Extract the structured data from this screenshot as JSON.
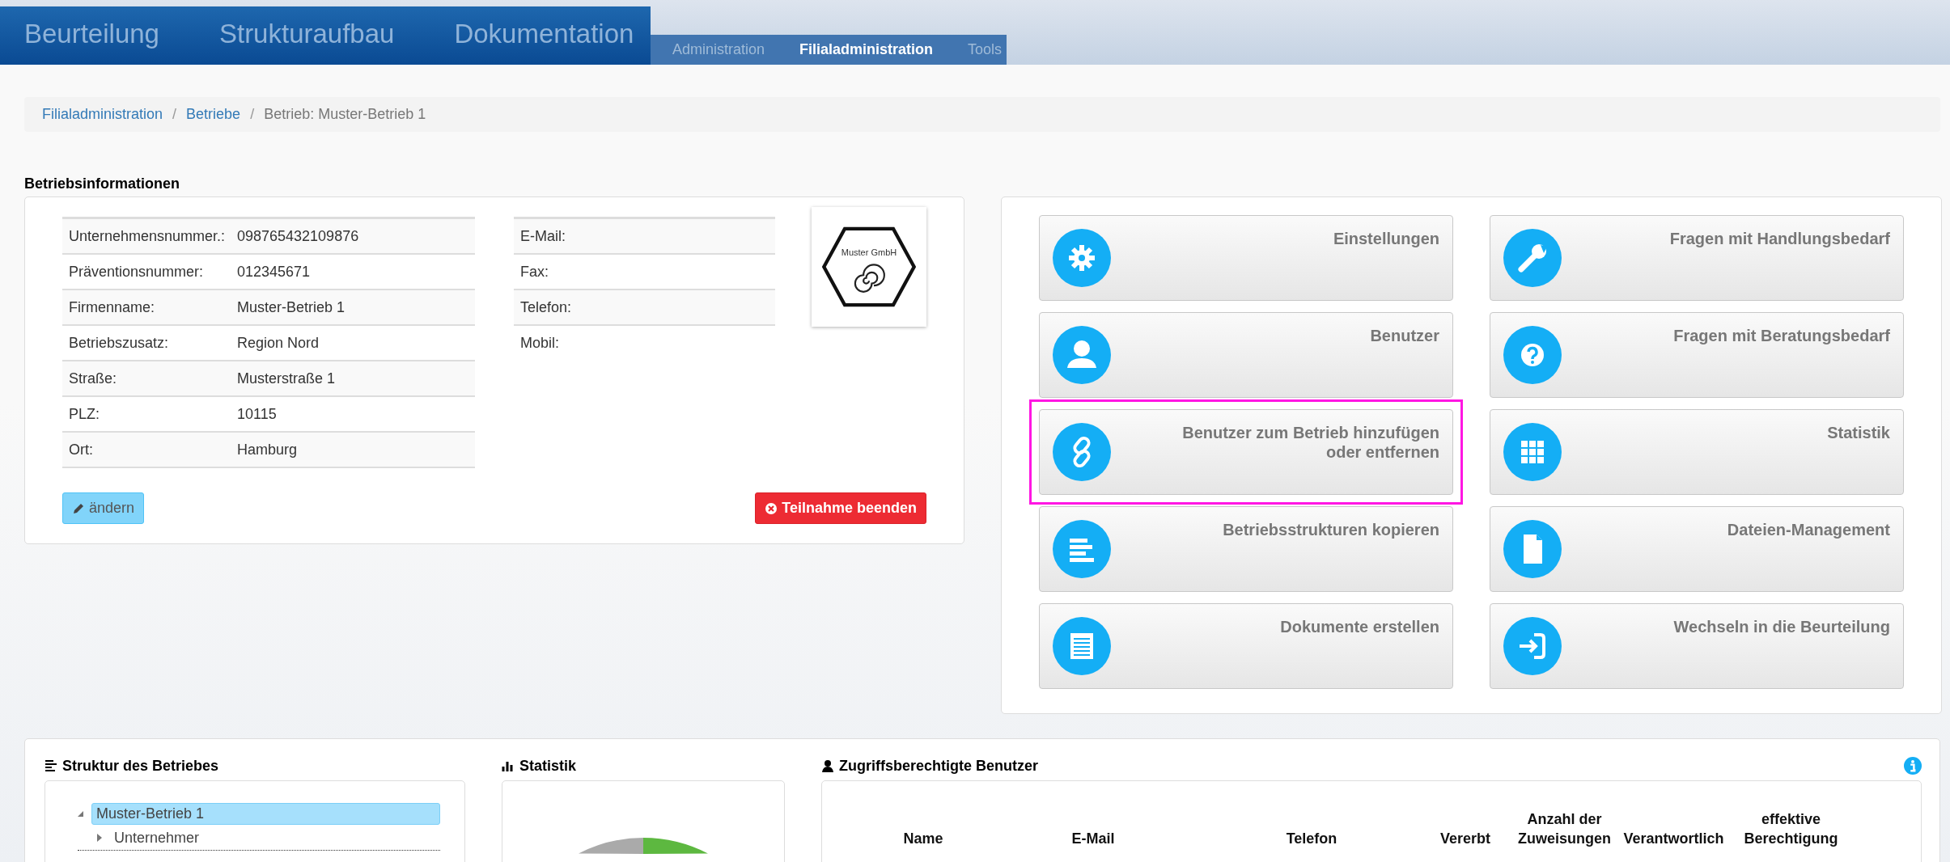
{
  "nav": {
    "main_tabs": [
      {
        "label": "Beurteilung",
        "selected": false
      },
      {
        "label": "Strukturaufbau",
        "selected": false
      },
      {
        "label": "Dokumentation",
        "selected": false
      }
    ],
    "sub_tabs": [
      {
        "label": "Administration",
        "selected": false
      },
      {
        "label": "Filialadministration",
        "selected": true
      },
      {
        "label": "Tools",
        "selected": false
      }
    ]
  },
  "breadcrumb": [
    {
      "label": "Filialadministration",
      "link": true,
      "separator": "/"
    },
    {
      "label": "Betriebe",
      "link": true,
      "separator": "/"
    },
    {
      "label": "Betrieb: Muster-Betrieb 1",
      "link": false
    }
  ],
  "info": {
    "title": "Betriebsinformationen",
    "fields_left": [
      {
        "label": "Unternehmensnummer.:",
        "value": "098765432109876"
      },
      {
        "label": "Präventionsnummer:",
        "value": "012345671"
      },
      {
        "label": "Firmenname:",
        "value": "Muster-Betrieb 1"
      },
      {
        "label": "Betriebszusatz:",
        "value": "Region Nord"
      },
      {
        "label": "Straße:",
        "value": "Musterstraße 1"
      },
      {
        "label": "PLZ:",
        "value": "10115"
      },
      {
        "label": "Ort:",
        "value": "Hamburg"
      }
    ],
    "fields_right": [
      {
        "label": "E-Mail:"
      },
      {
        "label": "Fax:"
      },
      {
        "label": "Telefon:"
      },
      {
        "label": "Mobil:"
      }
    ],
    "logo_text": "Muster GmbH",
    "edit_button": "ändern",
    "end_button": "Teilnahme beenden"
  },
  "actions": [
    {
      "label": "Einstellungen",
      "kind": "gear",
      "highlighted": false
    },
    {
      "label": "Fragen mit Handlungsbedarf",
      "kind": "wrench",
      "highlighted": false
    },
    {
      "label": "Benutzer",
      "kind": "user",
      "highlighted": false
    },
    {
      "label": "Fragen mit Beratungsbedarf",
      "kind": "question",
      "highlighted": false
    },
    {
      "label": "Benutzer zum Betrieb hinzufügen oder entfernen",
      "kind": "link",
      "highlighted": true
    },
    {
      "label": "Statistik",
      "kind": "grid",
      "highlighted": false
    },
    {
      "label": "Betriebsstrukturen kopieren",
      "kind": "lines",
      "highlighted": false
    },
    {
      "label": "Dateien-Management",
      "kind": "file",
      "highlighted": false
    },
    {
      "label": "Dokumente erstellen",
      "kind": "list",
      "highlighted": false
    },
    {
      "label": "Wechseln in die Beurteilung",
      "kind": "enter",
      "highlighted": false
    }
  ],
  "structure": {
    "title": "Struktur des Betriebes",
    "tree": [
      {
        "label": "Muster-Betrieb 1",
        "selected": true,
        "expanded": true,
        "children": [
          {
            "label": "Unternehmer",
            "selected": false,
            "expanded": false
          }
        ]
      }
    ]
  },
  "statistics": {
    "title": "Statistik"
  },
  "users": {
    "title": "Zugriffsberechtigte Benutzer",
    "columns": [
      "Name",
      "E-Mail",
      "Telefon",
      "Vererbt",
      "Anzahl der Zuweisungen",
      "Verantwortlich",
      "effektive Berechtigung"
    ]
  }
}
